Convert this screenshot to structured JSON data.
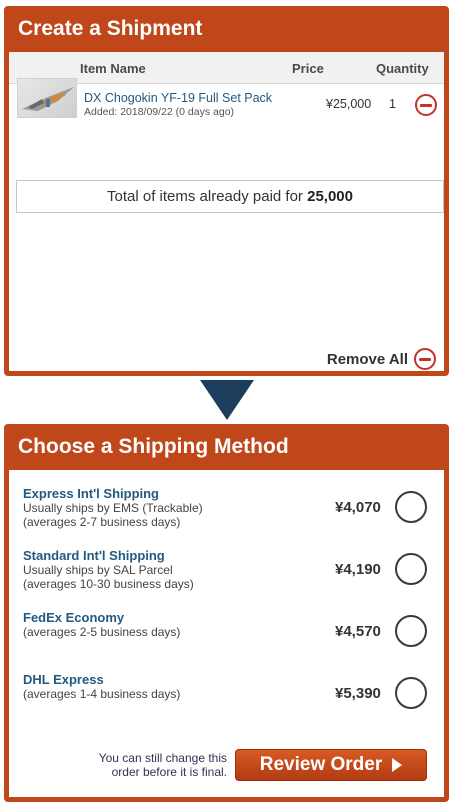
{
  "shipment": {
    "title": "Create a Shipment",
    "columns": {
      "item_name": "Item Name",
      "price": "Price",
      "quantity": "Quantity"
    },
    "items": [
      {
        "name": "DX Chogokin YF-19 Full Set Pack",
        "added": "Added: 2018/09/22 (0 days ago)",
        "price": "¥25,000",
        "quantity": "1"
      }
    ],
    "total_label": "Total of items already paid for",
    "total_value": "25,000",
    "remove_all_label": "Remove All"
  },
  "shipping": {
    "title": "Choose a Shipping Method",
    "options": [
      {
        "name": "Express Int'l Shipping",
        "desc1": "Usually ships by EMS (Trackable)",
        "desc2": "(averages 2-7 business days)",
        "price": "¥4,070"
      },
      {
        "name": "Standard Int'l Shipping",
        "desc1": "Usually ships by SAL Parcel",
        "desc2": "(averages 10-30 business days)",
        "price": "¥4,190"
      },
      {
        "name": "FedEx Economy",
        "desc1": "(averages 2-5 business days)",
        "desc2": "",
        "price": "¥4,570"
      },
      {
        "name": "DHL Express",
        "desc1": "(averages 1-4 business days)",
        "desc2": "",
        "price": "¥5,390"
      }
    ],
    "footnote_line1": "You can still change this",
    "footnote_line2": "order before it is final.",
    "review_label": "Review Order"
  },
  "colors": {
    "panel": "#c0471a",
    "link": "#235a82",
    "remove": "#c8302a",
    "arrow": "#1c3e5c"
  },
  "icons": {
    "remove": "minus-circle-icon",
    "next": "play-icon",
    "step": "arrow-down-icon"
  }
}
